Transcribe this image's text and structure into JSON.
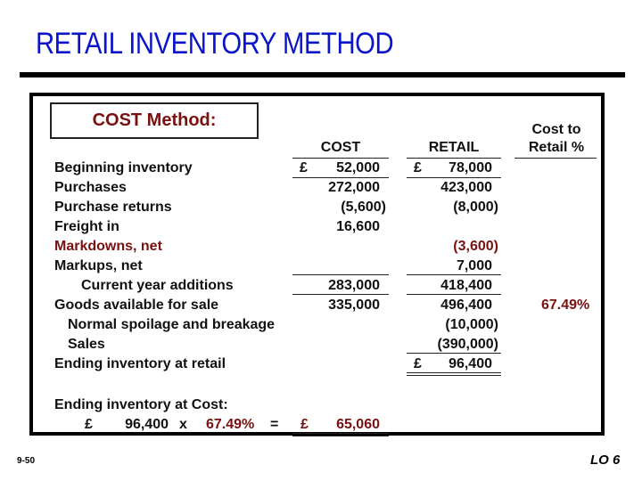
{
  "slide": {
    "title": "RETAIL INVENTORY METHOD",
    "page_number": "9-50",
    "learning_objective": "LO 6",
    "title_color": "#0a14c8",
    "accent_color": "#7a1010"
  },
  "method_box": {
    "label": "COST Method:"
  },
  "columns": {
    "cost": "COST",
    "retail": "RETAIL",
    "ratio_line1": "Cost to",
    "ratio_line2": "Retail %"
  },
  "currency_symbol": "£",
  "rows": [
    {
      "label": "Beginning inventory",
      "cost": "52,000",
      "retail": "78,000",
      "ratio": ""
    },
    {
      "label": "Purchases",
      "cost": "272,000",
      "retail": "423,000",
      "ratio": ""
    },
    {
      "label": "Purchase returns",
      "cost": "(5,600)",
      "retail": "(8,000)",
      "ratio": ""
    },
    {
      "label": "Freight in",
      "cost": "16,600",
      "retail": "",
      "ratio": ""
    },
    {
      "label": "Markdowns, net",
      "cost": "",
      "retail": "(3,600)",
      "ratio": ""
    },
    {
      "label": "Markups, net",
      "cost": "",
      "retail": "7,000",
      "ratio": ""
    },
    {
      "label": "Current year additions",
      "cost": "283,000",
      "retail": "418,400",
      "ratio": ""
    },
    {
      "label": "Goods available for sale",
      "cost": "335,000",
      "retail": "496,400",
      "ratio": "67.49%"
    },
    {
      "label": "Normal spoilage and breakage",
      "cost": "",
      "retail": "(10,000)",
      "ratio": ""
    },
    {
      "label": "Sales",
      "cost": "",
      "retail": "(390,000)",
      "ratio": ""
    },
    {
      "label": "Ending inventory at retail",
      "cost": "",
      "retail": "96,400",
      "ratio": ""
    }
  ],
  "ending_cost": {
    "label": "Ending inventory at Cost:",
    "retail_value": "96,400",
    "times": "x",
    "ratio": "67.49%",
    "equals": "=",
    "result": "65,060"
  }
}
